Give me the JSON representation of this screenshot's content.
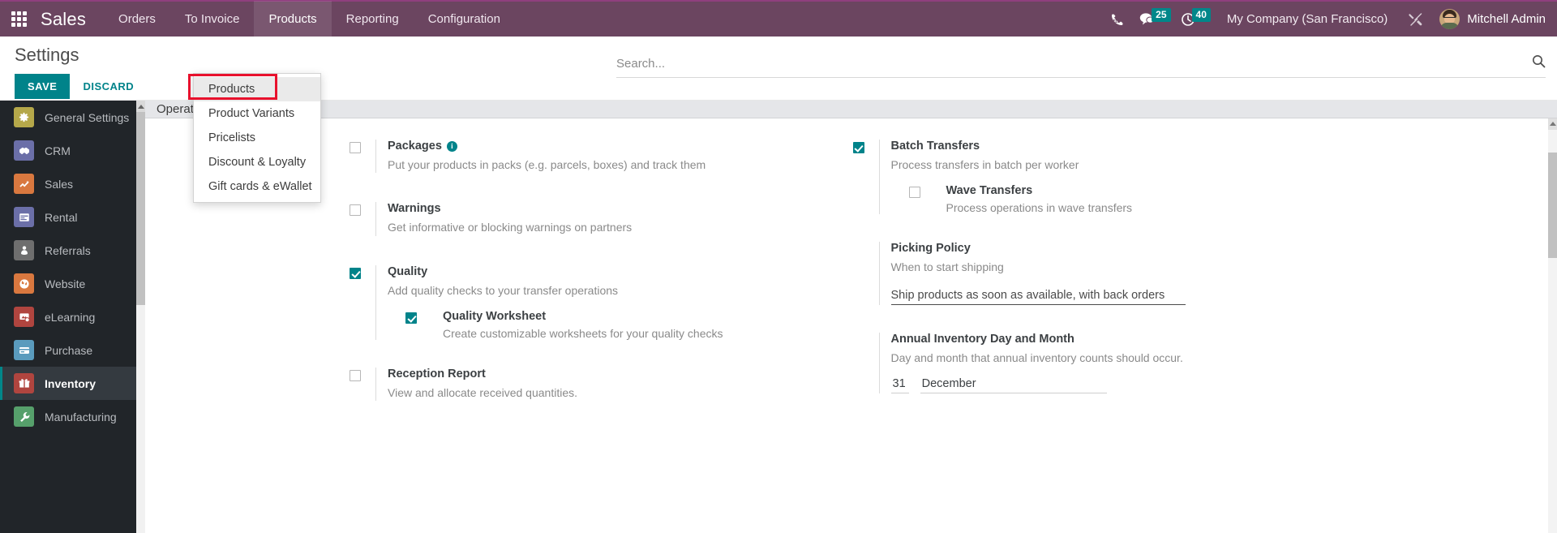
{
  "navbar": {
    "apps_icon": "apps-grid-icon",
    "brand": "Sales",
    "links": [
      {
        "label": "Orders",
        "active": false
      },
      {
        "label": "To Invoice",
        "active": false
      },
      {
        "label": "Products",
        "active": true
      },
      {
        "label": "Reporting",
        "active": false
      },
      {
        "label": "Configuration",
        "active": false
      }
    ],
    "dialpad_icon": "dialpad-icon",
    "messages_icon": "chat-bubble-icon",
    "messages_count": "25",
    "activities_icon": "clock-icon",
    "activities_count": "40",
    "company": "My Company (San Francisco)",
    "tools_icon": "wrench-tools-icon",
    "user_name": "Mitchell Admin"
  },
  "dropdown": {
    "items": [
      {
        "label": "Products",
        "highlighted": true
      },
      {
        "label": "Product Variants",
        "highlighted": false
      },
      {
        "label": "Pricelists",
        "highlighted": false
      },
      {
        "label": "Discount & Loyalty",
        "highlighted": false
      },
      {
        "label": "Gift cards & eWallet",
        "highlighted": false
      }
    ]
  },
  "control_panel": {
    "title": "Settings",
    "save_label": "SAVE",
    "discard_label": "DISCARD",
    "search_placeholder": "Search...",
    "search_value": "",
    "search_icon": "search-icon"
  },
  "sidebar": {
    "items": [
      {
        "label": "General Settings",
        "icon": "gear-icon",
        "color": "#b5a84a",
        "glyph": "⚙",
        "active": false
      },
      {
        "label": "CRM",
        "icon": "handshake-icon",
        "color": "#6b6fa8",
        "glyph": "☝",
        "active": false
      },
      {
        "label": "Sales",
        "icon": "chart-line-icon",
        "color": "#d9783f",
        "glyph": "↗",
        "active": false
      },
      {
        "label": "Rental",
        "icon": "calendar-icon",
        "color": "#6b6fa8",
        "glyph": "▤",
        "active": false
      },
      {
        "label": "Referrals",
        "icon": "person-icon",
        "color": "#6e6e6e",
        "glyph": "♟",
        "active": false
      },
      {
        "label": "Website",
        "icon": "globe-icon",
        "color": "#d9783f",
        "glyph": "◉",
        "active": false
      },
      {
        "label": "eLearning",
        "icon": "presentation-icon",
        "color": "#b0453f",
        "glyph": "▣",
        "active": false
      },
      {
        "label": "Purchase",
        "icon": "card-icon",
        "color": "#5a9bbd",
        "glyph": "▭",
        "active": false
      },
      {
        "label": "Inventory",
        "icon": "box-icon",
        "color": "#b0453f",
        "glyph": "❑",
        "active": true
      },
      {
        "label": "Manufacturing",
        "icon": "wrench-icon",
        "color": "#56a06b",
        "glyph": "⚒",
        "active": false
      }
    ]
  },
  "content": {
    "section_title": "Operations",
    "left_settings": [
      {
        "name": "packages",
        "title": "Packages",
        "description": "Put your products in packs (e.g. parcels, boxes) and track them",
        "checked": false,
        "has_info": true
      },
      {
        "name": "warnings",
        "title": "Warnings",
        "description": "Get informative or blocking warnings on partners",
        "checked": false,
        "has_info": false
      },
      {
        "name": "quality",
        "title": "Quality",
        "description": "Add quality checks to your transfer operations",
        "checked": true,
        "has_info": false,
        "sub": {
          "title": "Quality Worksheet",
          "description": "Create customizable worksheets for your quality checks",
          "checked": true
        }
      },
      {
        "name": "reception-report",
        "title": "Reception Report",
        "description": "View and allocate received quantities.",
        "checked": false,
        "has_info": false
      }
    ],
    "right_settings": {
      "batch_transfers": {
        "title": "Batch Transfers",
        "description": "Process transfers in batch per worker",
        "checked": true,
        "sub": {
          "title": "Wave Transfers",
          "description": "Process operations in wave transfers",
          "checked": false
        }
      },
      "picking_policy": {
        "title": "Picking Policy",
        "description": "When to start shipping",
        "value": "Ship products as soon as available, with back orders"
      },
      "annual_inventory": {
        "title": "Annual Inventory Day and Month",
        "description": "Day and month that annual inventory counts should occur.",
        "day": "31",
        "month": "December"
      }
    }
  },
  "colors": {
    "navbar_bg": "#6b4560",
    "accent_teal": "#00838a",
    "sidebar_bg": "#212529",
    "highlight_red": "#e8112d"
  }
}
